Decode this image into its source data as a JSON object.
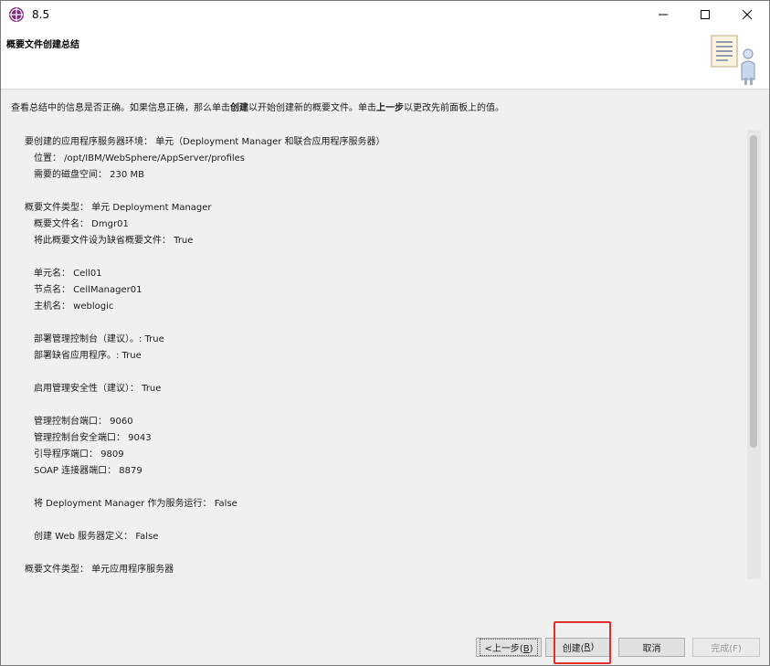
{
  "window": {
    "title": "8.5",
    "icon": "was-globe-icon",
    "minimize_icon": "minimize-icon",
    "maximize_icon": "maximize-icon",
    "close_icon": "close-icon"
  },
  "banner": {
    "title": "概要文件创建总结",
    "graphic": "checklist-person-icon"
  },
  "description": {
    "prefix": "查看总结中的信息是否正确。如果信息正确，那么单击",
    "create_word": "创建",
    "middle": "以开始创建新的概要文件。单击",
    "back_word": "上一步",
    "suffix": "以更改先前面板上的值。"
  },
  "summary": {
    "lines": [
      {
        "text": "要创建的应用程序服务器环境： 单元（Deployment Manager 和联合应用程序服务器）",
        "indent": 0
      },
      {
        "text": "位置： /opt/IBM/WebSphere/AppServer/profiles",
        "indent": 1
      },
      {
        "text": "需要的磁盘空间： 230 MB",
        "indent": 1
      },
      {
        "text": "",
        "indent": 0
      },
      {
        "text": "概要文件类型： 单元 Deployment Manager",
        "indent": 0
      },
      {
        "text": "概要文件名： Dmgr01",
        "indent": 1
      },
      {
        "text": "将此概要文件设为缺省概要文件： True",
        "indent": 1
      },
      {
        "text": "",
        "indent": 0
      },
      {
        "text": "单元名： Cell01",
        "indent": 1
      },
      {
        "text": "节点名： CellManager01",
        "indent": 1
      },
      {
        "text": "主机名： weblogic",
        "indent": 1
      },
      {
        "text": "",
        "indent": 0
      },
      {
        "text": "部署管理控制台（建议）。: True",
        "indent": 1
      },
      {
        "text": "部署缺省应用程序。: True",
        "indent": 1
      },
      {
        "text": "",
        "indent": 0
      },
      {
        "text": "启用管理安全性（建议）： True",
        "indent": 1
      },
      {
        "text": "",
        "indent": 0
      },
      {
        "text": "管理控制台端口： 9060",
        "indent": 1
      },
      {
        "text": "管理控制台安全端口： 9043",
        "indent": 1
      },
      {
        "text": "引导程序端口： 9809",
        "indent": 1
      },
      {
        "text": "SOAP 连接器端口： 8879",
        "indent": 1
      },
      {
        "text": "",
        "indent": 0
      },
      {
        "text": "将 Deployment Manager 作为服务运行： False",
        "indent": 1
      },
      {
        "text": "",
        "indent": 0
      },
      {
        "text": "创建 Web 服务器定义： False",
        "indent": 1
      },
      {
        "text": "",
        "indent": 0
      },
      {
        "text": "概要文件类型： 单元应用程序服务器",
        "indent": 0
      }
    ]
  },
  "buttons": {
    "back": {
      "text": "<上一步(",
      "mnemonic": "B",
      "close": ")"
    },
    "create": {
      "text": "创建(",
      "mnemonic": "R",
      "close": ")"
    },
    "cancel": "取消",
    "finish": "完成(F)"
  },
  "colors": {
    "highlight": "#e22d2d",
    "dialog_bg": "#f0f0f0"
  }
}
